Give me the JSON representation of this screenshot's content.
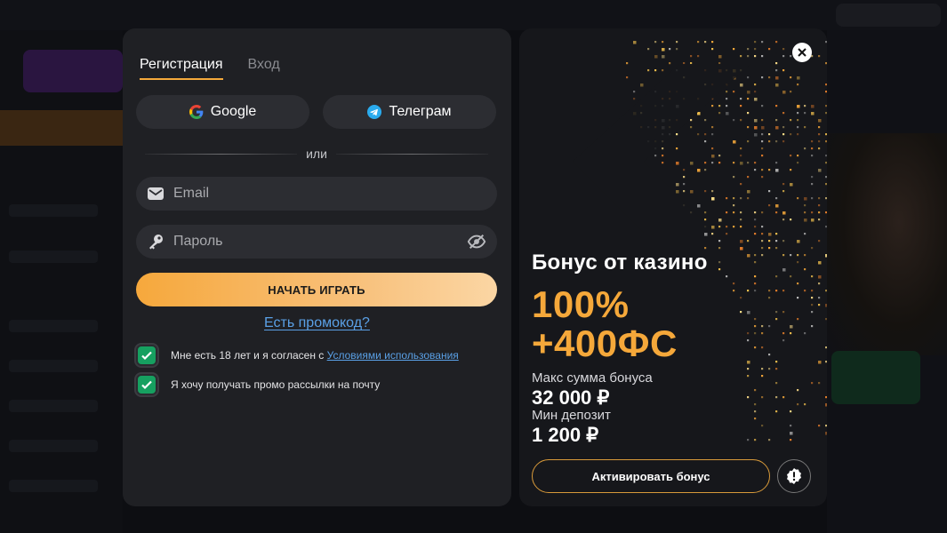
{
  "tabs": [
    {
      "label": "Регистрация",
      "active": true
    },
    {
      "label": "Вход",
      "active": false
    }
  ],
  "social": {
    "google_label": "Google",
    "telegram_label": "Телеграм"
  },
  "divider_text": "или",
  "form": {
    "email_placeholder": "Email",
    "password_placeholder": "Пароль",
    "submit_label": "НАЧАТЬ ИГРАТЬ",
    "promo_link": "Есть промокод?"
  },
  "consents": [
    {
      "text": "Мне есть 18 лет и я согласен с ",
      "link": "Условиями использования",
      "checked": true
    },
    {
      "text": "Я хочу получать промо рассылки на почту",
      "checked": true
    }
  ],
  "bonus": {
    "title": "Бонус от казино",
    "percent": "100%",
    "free_spins": "+400ФС",
    "max_label": "Макс сумма бонуса",
    "max_value": "32 000 ₽",
    "min_label": "Мин депозит",
    "min_value": "1 200 ₽",
    "activate_label": "Активировать бонус"
  },
  "colors": {
    "accent": "#f5a83a",
    "link": "#5aa0e6",
    "check": "#16a060",
    "panel": "#1f2024"
  }
}
